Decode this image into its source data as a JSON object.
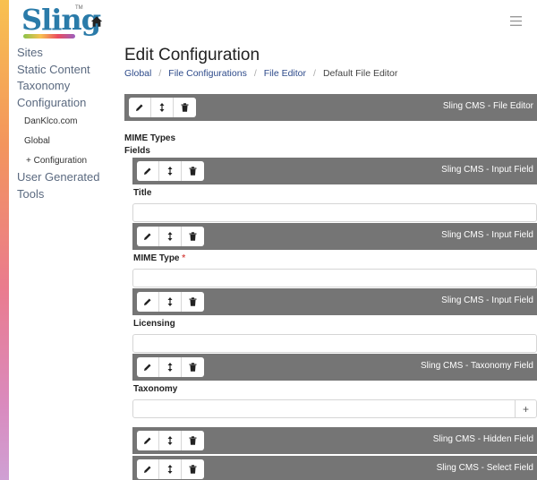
{
  "brand": {
    "name": "Sling",
    "trademark": "TM"
  },
  "sidebar": {
    "items": [
      {
        "label": "Sites"
      },
      {
        "label": "Static Content"
      },
      {
        "label": "Taxonomy"
      },
      {
        "label": "Configuration"
      }
    ],
    "sub_items": [
      {
        "label": "DanKlco.com"
      },
      {
        "label": "Global"
      },
      {
        "label": "+ Configuration"
      }
    ],
    "items_after": [
      {
        "label": "User Generated"
      },
      {
        "label": "Tools"
      }
    ]
  },
  "page": {
    "title": "Edit Configuration"
  },
  "breadcrumb": [
    {
      "label": "Global"
    },
    {
      "label": "File Configurations"
    },
    {
      "label": "File Editor"
    },
    {
      "label": "Default File Editor"
    }
  ],
  "components": {
    "file_editor": "Sling CMS - File Editor",
    "input_field_1": "Sling CMS - Input Field",
    "input_field_2": "Sling CMS - Input Field",
    "input_field_3": "Sling CMS - Input Field",
    "taxonomy_field": "Sling CMS - Taxonomy Field",
    "hidden_field": "Sling CMS - Hidden Field",
    "select_field": "Sling CMS - Select Field"
  },
  "labels": {
    "mime_types": "MIME Types",
    "fields": "Fields",
    "title": "Title",
    "mime_type": "MIME Type",
    "required_marker": "*",
    "licensing": "Licensing",
    "taxonomy": "Taxonomy"
  },
  "taxonomy_add": "+",
  "icons": {
    "edit": "pencil-icon",
    "move": "arrows-vertical-icon",
    "delete": "trash-icon",
    "home": "home-icon",
    "menu": "hamburger-menu-icon"
  }
}
